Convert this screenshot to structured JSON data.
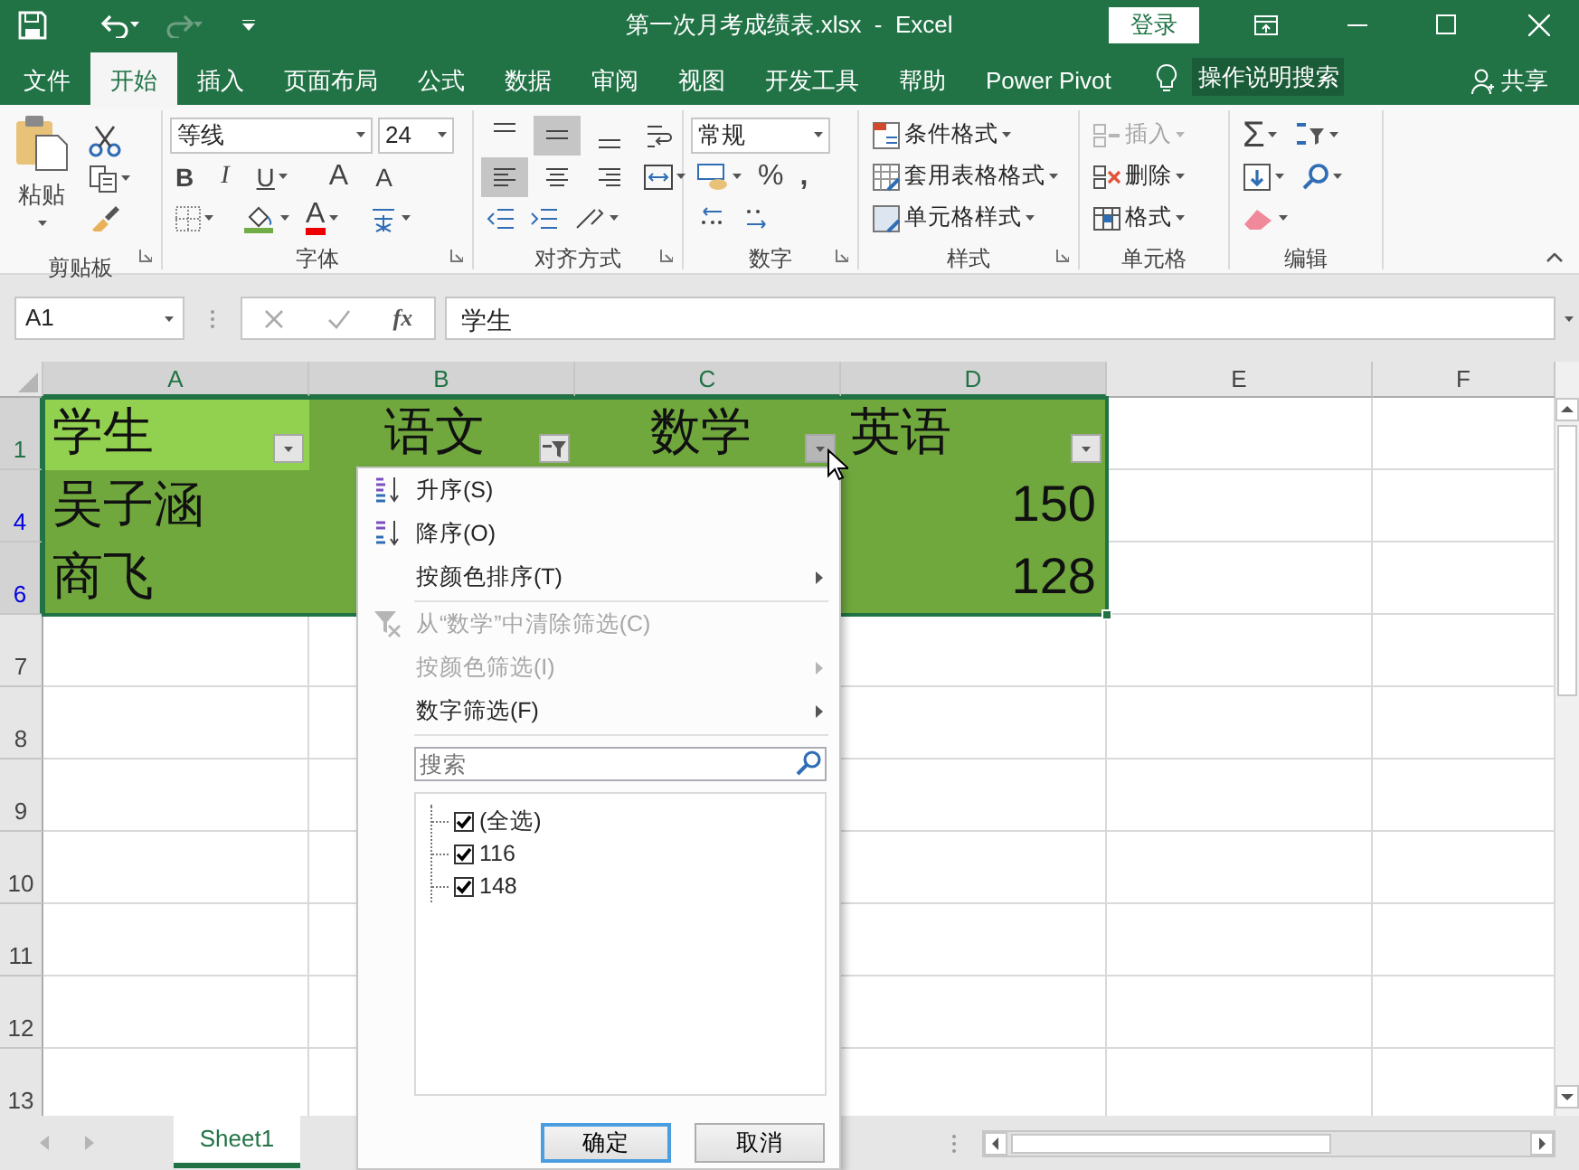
{
  "window": {
    "title": "第一次月考成绩表.xlsx  -  Excel",
    "sign_in": "登录"
  },
  "ribbon_tabs": [
    {
      "label": "文件",
      "selected": false
    },
    {
      "label": "开始",
      "selected": true
    },
    {
      "label": "插入",
      "selected": false
    },
    {
      "label": "页面布局",
      "selected": false
    },
    {
      "label": "公式",
      "selected": false
    },
    {
      "label": "数据",
      "selected": false
    },
    {
      "label": "审阅",
      "selected": false
    },
    {
      "label": "视图",
      "selected": false
    },
    {
      "label": "开发工具",
      "selected": false
    },
    {
      "label": "帮助",
      "selected": false
    },
    {
      "label": "Power Pivot",
      "selected": false
    }
  ],
  "tell_me": "操作说明搜索",
  "share": "共享",
  "ribbon": {
    "clipboard": {
      "paste": "粘贴",
      "label": "剪贴板"
    },
    "font": {
      "font_name": "等线",
      "font_size": "24",
      "bold": "B",
      "italic": "I",
      "underline": "U",
      "grow": "A",
      "shrink": "A",
      "font_color": "A",
      "label": "字体"
    },
    "alignment": {
      "vertical": [
        {
          "selected": false
        },
        {
          "selected": true
        },
        {
          "selected": false
        }
      ],
      "horizontal": [
        {
          "selected": true
        },
        {
          "selected": false
        },
        {
          "selected": false
        }
      ],
      "label": "对齐方式"
    },
    "number": {
      "format": "常规",
      "percent": "%",
      "comma": ",",
      "label": "数字"
    },
    "styles": {
      "items": [
        "条件格式",
        "套用表格格式",
        "单元格样式"
      ],
      "label": "样式"
    },
    "cells": {
      "items": [
        {
          "label": "插入",
          "disabled": true
        },
        {
          "label": "删除",
          "disabled": false
        },
        {
          "label": "格式",
          "disabled": false
        }
      ],
      "label": "单元格"
    },
    "editing": {
      "sum": "Σ",
      "label": "编辑"
    }
  },
  "formula_bar": {
    "name_box": "A1",
    "function_label": "fx",
    "value": "学生"
  },
  "sheet": {
    "columns": [
      {
        "label": "A",
        "selected": true
      },
      {
        "label": "B",
        "selected": true
      },
      {
        "label": "C",
        "selected": true
      },
      {
        "label": "D",
        "selected": true
      },
      {
        "label": "E",
        "selected": false
      },
      {
        "label": "F",
        "selected": false
      }
    ],
    "rows": [
      {
        "header": "1",
        "selected": true,
        "filtered": false,
        "cells": [
          {
            "text": "学生",
            "color": "#92d050",
            "centered": false,
            "filter": {
              "applied": false,
              "open": false
            }
          },
          {
            "text": "语文",
            "color": "#70a83e",
            "centered": true,
            "filter": {
              "applied": true,
              "open": false
            }
          },
          {
            "text": "数学",
            "color": "#70a83e",
            "centered": true,
            "filter": {
              "applied": false,
              "open": true
            }
          },
          {
            "text": "英语",
            "color": "#70a83e",
            "centered": false,
            "filter": {
              "applied": false,
              "open": false
            }
          }
        ]
      },
      {
        "header": "4",
        "selected": true,
        "filtered": true,
        "cells": [
          {
            "text": "吴子涵",
            "color": "#70a83e",
            "kind": "text"
          },
          {
            "color": "#70a83e",
            "kind": "text"
          },
          null,
          {
            "text": "150",
            "color": "#70a83e",
            "kind": "number"
          }
        ]
      },
      {
        "header": "6",
        "selected": true,
        "filtered": true,
        "cells": [
          {
            "text": "商飞",
            "color": "#70a83e",
            "kind": "text"
          },
          {
            "color": "#70a83e",
            "kind": "text"
          },
          null,
          {
            "text": "128",
            "color": "#70a83e",
            "kind": "number"
          }
        ]
      },
      {
        "header": "7",
        "selected": false,
        "filtered": false
      },
      {
        "header": "8",
        "selected": false,
        "filtered": false
      },
      {
        "header": "9",
        "selected": false,
        "filtered": false
      },
      {
        "header": "10",
        "selected": false,
        "filtered": false
      },
      {
        "header": "11",
        "selected": false,
        "filtered": false
      },
      {
        "header": "12",
        "selected": false,
        "filtered": false
      },
      {
        "header": "13",
        "selected": false,
        "filtered": false
      }
    ]
  },
  "sheet_tabs": [
    {
      "label": "Sheet1",
      "selected": true
    }
  ],
  "filter_menu": {
    "items": [
      {
        "label": "升序(S)",
        "kind": "sort_ascending",
        "disabled": false,
        "submenu": false
      },
      {
        "label": "降序(O)",
        "kind": "sort_descending",
        "disabled": false,
        "submenu": false
      },
      {
        "label": "按颜色排序(T)",
        "kind": "plain",
        "disabled": false,
        "submenu": true
      },
      {
        "label": "从“数学”中清除筛选(C)",
        "kind": "clear_filter",
        "disabled": true,
        "submenu": false
      },
      {
        "label": "按颜色筛选(I)",
        "kind": "plain",
        "disabled": true,
        "submenu": true
      },
      {
        "label": "数字筛选(F)",
        "kind": "plain",
        "disabled": false,
        "submenu": true
      }
    ],
    "search": {
      "placeholder": "搜索"
    },
    "values": [
      {
        "label": "(全选)",
        "checked": true,
        "children": [
          {
            "label": "116",
            "checked": true
          },
          {
            "label": "148",
            "checked": true
          }
        ]
      }
    ],
    "buttons": [
      {
        "label": "确定",
        "default": true
      },
      {
        "label": "取消",
        "default": false
      }
    ]
  }
}
